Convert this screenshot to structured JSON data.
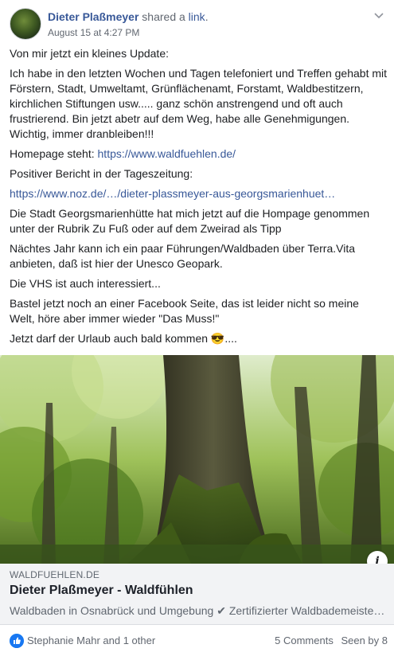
{
  "header": {
    "author": "Dieter Plaßmeyer",
    "shared_prefix": " shared a ",
    "shared_link": "link",
    "shared_suffix": ".",
    "date": "August 15 at 4:27 PM"
  },
  "body": {
    "p1": "Von mir jetzt ein kleines Update:",
    "p2": "Ich habe in den letzten Wochen und Tagen telefoniert und Treffen gehabt mit Förstern, Stadt, Umweltamt, Grünflächenamt, Forstamt, Waldbestitzern, kirchlichen Stiftungen usw..... ganz schön anstrengend und oft auch frustrierend. Bin jetzt abetr auf dem Weg, habe alle Genehmigungen. Wichtig, immer dranbleiben!!!",
    "p3_prefix": "Homepage steht: ",
    "p3_link": "https://www.waldfuehlen.de/",
    "p4": "Positiver Bericht in der Tageszeitung:",
    "p5_link": "https://www.noz.de/…/dieter-plassmeyer-aus-georgsmarienhuet…",
    "p6": "Die Stadt Georgsmarienhütte hat mich jetzt auf die Hompage genommen unter der Rubrik Zu Fuß oder auf dem Zweirad als Tipp",
    "p7": "Nächtes Jahr kann ich ein paar Führungen/Waldbaden über Terra.Vita anbieten, daß ist hier der Unesco Geopark.",
    "p8": "Die VHS ist auch interessiert...",
    "p9": "Bastel jetzt noch an einer Facebook Seite, das ist leider nicht so meine Welt, höre aber immer wieder \"Das Muss!\"",
    "p10_prefix": "Jetzt darf der Urlaub auch bald kommen ",
    "p10_emoji": "😎",
    "p10_suffix": "...."
  },
  "link_card": {
    "domain": "WALDFUEHLEN.DE",
    "title": "Dieter Plaßmeyer - Waldfühlen",
    "description": "Waldbaden in Osnabrück und Umgebung ✔ Zertifizierter Waldbademeister…",
    "info_glyph": "i"
  },
  "footer": {
    "likers": "Stephanie Mahr and 1 other",
    "comments": "5 Comments",
    "seen": "Seen by 8"
  },
  "colors": {
    "link": "#385898",
    "secondary_text": "#616770",
    "card_bg": "#f2f3f5",
    "like_blue": "#1877f2"
  },
  "icons": [
    "avatar",
    "chevron-down-icon",
    "sunglasses-emoji",
    "info-icon",
    "like-icon"
  ]
}
